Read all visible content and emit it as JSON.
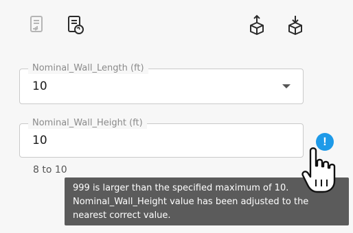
{
  "toolbar": {
    "icons": [
      {
        "name": "export-doc-icon",
        "state": "disabled"
      },
      {
        "name": "refresh-doc-icon",
        "state": "enabled"
      },
      {
        "name": "upload-cube-icon",
        "state": "enabled"
      },
      {
        "name": "download-cube-icon",
        "state": "enabled"
      }
    ]
  },
  "fields": {
    "length": {
      "label": "Nominal_Wall_Length (ft)",
      "value": "10"
    },
    "height": {
      "label": "Nominal_Wall_Height (ft)",
      "value": "10",
      "hint": "8 to 10"
    }
  },
  "tooltip": {
    "line1": "999 is larger than the specified maximum of 10.",
    "line2": "Nominal_Wall_Height value has been adjusted to the",
    "line3": "nearest correct value."
  },
  "warning": {
    "symbol": "!",
    "color": "#1e9ae8"
  },
  "colors": {
    "tooltip_bg": "#5b5b5b",
    "accent": "#1e9ae8",
    "disabled_icon": "#b5b5b5",
    "icon": "#2a2a2a"
  }
}
